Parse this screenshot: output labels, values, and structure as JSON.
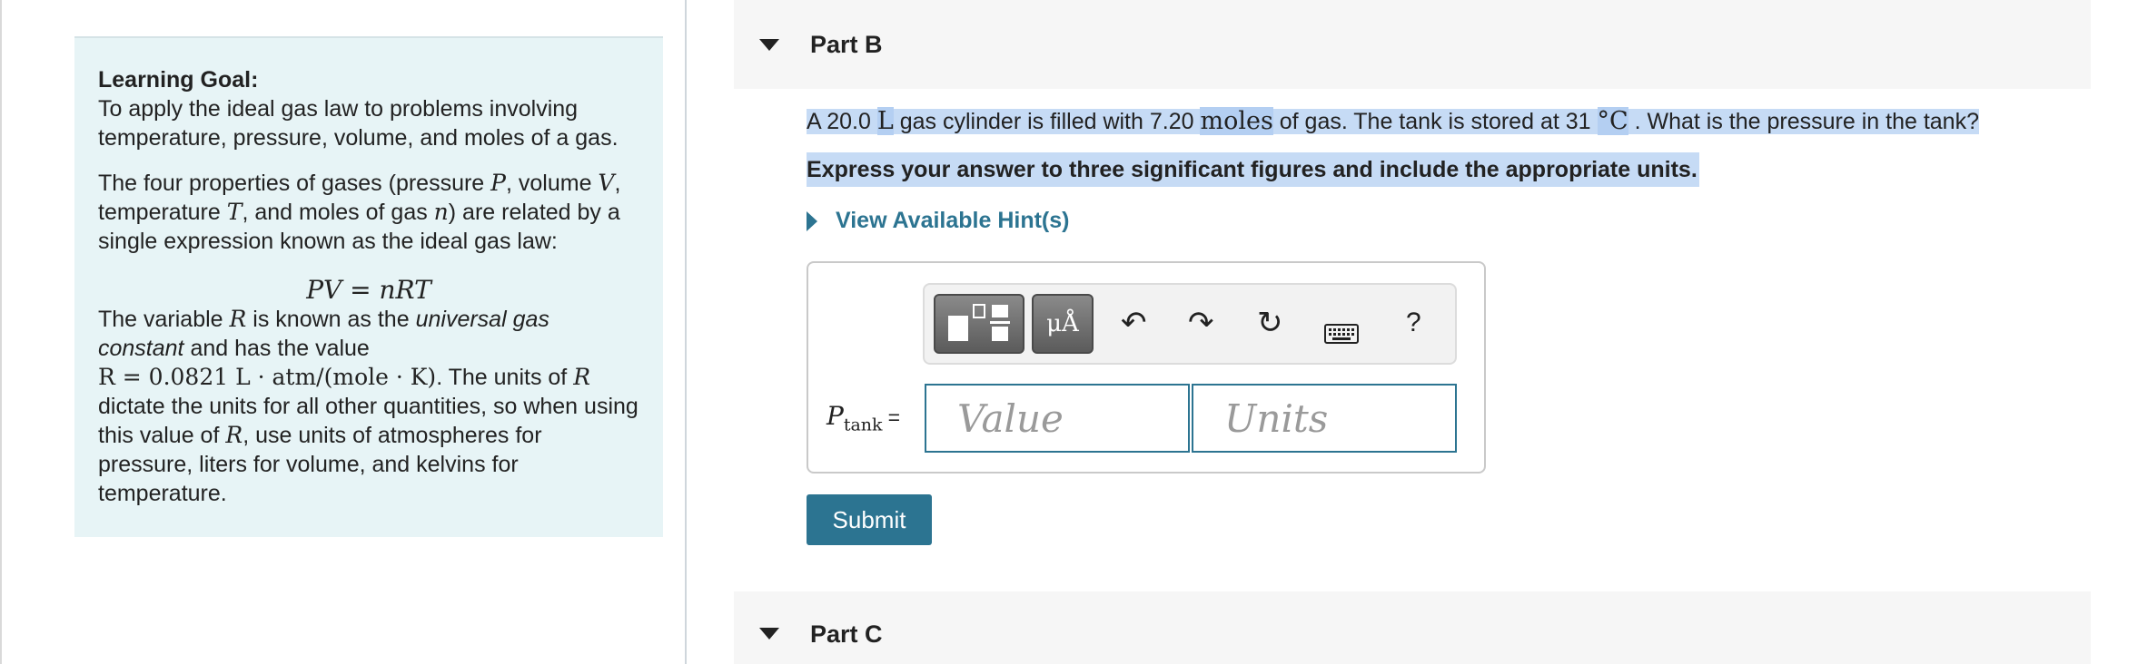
{
  "learning_goal": {
    "title": "Learning Goal:",
    "intro": "To apply the ideal gas law to problems involving temperature, pressure, volume, and moles of a gas.",
    "p2_a": "The four properties of gases (pressure ",
    "p2_P": "P",
    "p2_b": ", volume ",
    "p2_V": "V",
    "p2_c": ", temperature ",
    "p2_T": "T",
    "p2_d": ", and moles of gas ",
    "p2_n": "n",
    "p2_e": ") are related by a single expression known as the ideal gas law:",
    "equation": "PV = nRT",
    "p3_a": "The variable ",
    "p3_R": "R",
    "p3_b": " is known as the ",
    "p3_italic": "universal gas constant",
    "p3_c": " and has the value",
    "p3_value": "R = 0.0821 L · atm/(mole · K)",
    "p3_d": ". The units of ",
    "p3_R2": "R",
    "p3_e": " dictate the units for all other quantities, so when using this value of ",
    "p3_R3": "R",
    "p3_f": ", use units of atmospheres for pressure, liters for volume, and kelvins for temperature."
  },
  "part_b": {
    "label": "Part B",
    "q1": "A 20.0 ",
    "q_L": "L",
    "q2": " gas cylinder is filled with 7.20 ",
    "q_moles": "moles",
    "q3": " of gas. The tank is stored at 31 ",
    "q_degC": "°C",
    "q4": " . What is the pressure in the tank?",
    "instruction": "Express your answer to three significant figures and include the appropriate units.",
    "hints": "View Available Hint(s)",
    "toolbar": {
      "units_label": "μÅ",
      "undo": "↶",
      "redo": "↷",
      "reset": "↻",
      "keyboard": "⌨",
      "help": "?"
    },
    "variable": "P",
    "variable_sub": "tank",
    "equals": "=",
    "value_placeholder": "Value",
    "units_placeholder": "Units",
    "submit": "Submit"
  },
  "part_c": {
    "label": "Part C"
  }
}
